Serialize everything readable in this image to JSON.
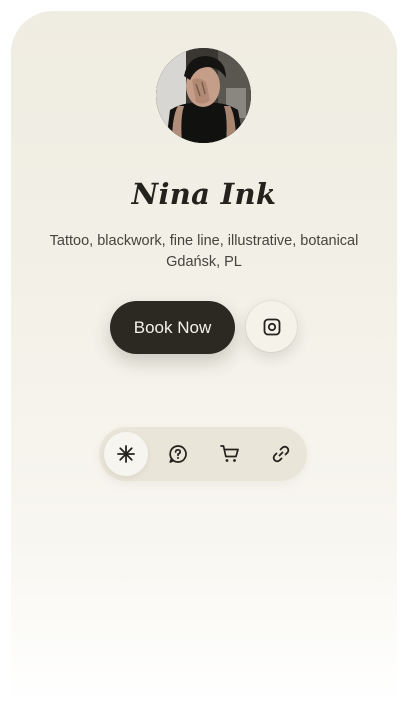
{
  "profile": {
    "name": "Nina Ink",
    "bio_line1": "Tattoo, blackwork, fine line, illustrative, botanical",
    "location": "Gdańsk, PL",
    "avatar": "profile-photo"
  },
  "actions": {
    "book_label": "Book Now",
    "instagram_icon": "instagram-icon"
  },
  "nav": {
    "items": [
      {
        "icon": "asterisk-icon",
        "active": true
      },
      {
        "icon": "question-bubble-icon",
        "active": false
      },
      {
        "icon": "cart-icon",
        "active": false
      },
      {
        "icon": "link-icon",
        "active": false
      }
    ]
  },
  "colors": {
    "card_bg": "#efece1",
    "button_dark": "#2c2922",
    "text_dark": "#24221d"
  }
}
